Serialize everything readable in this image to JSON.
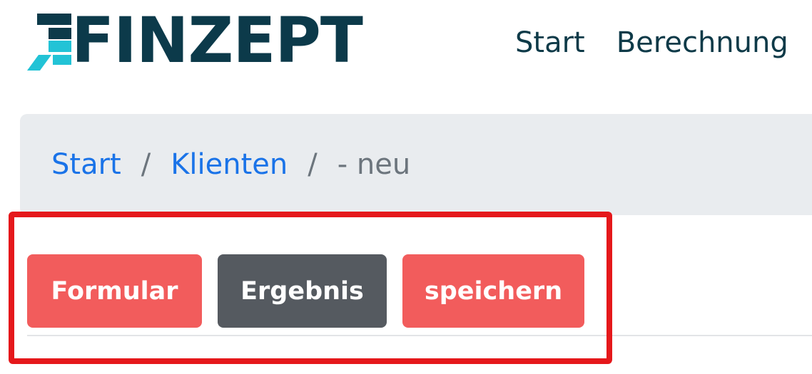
{
  "header": {
    "logo_text": "FINZEPT",
    "nav": [
      {
        "label": "Start"
      },
      {
        "label": "Berechnung"
      }
    ]
  },
  "breadcrumb": {
    "items": [
      {
        "label": "Start"
      },
      {
        "label": "Klienten"
      }
    ],
    "separator": "/",
    "current": "- neu"
  },
  "actions": {
    "formular_label": "Formular",
    "ergebnis_label": "Ergebnis",
    "speichern_label": "speichern"
  },
  "colors": {
    "brand_dark": "#0c3a4a",
    "brand_cyan": "#22c3d6",
    "link_blue": "#1a73e8",
    "button_red": "#f25c5c",
    "button_dark": "#555a60",
    "highlight_red": "#e5181b"
  }
}
